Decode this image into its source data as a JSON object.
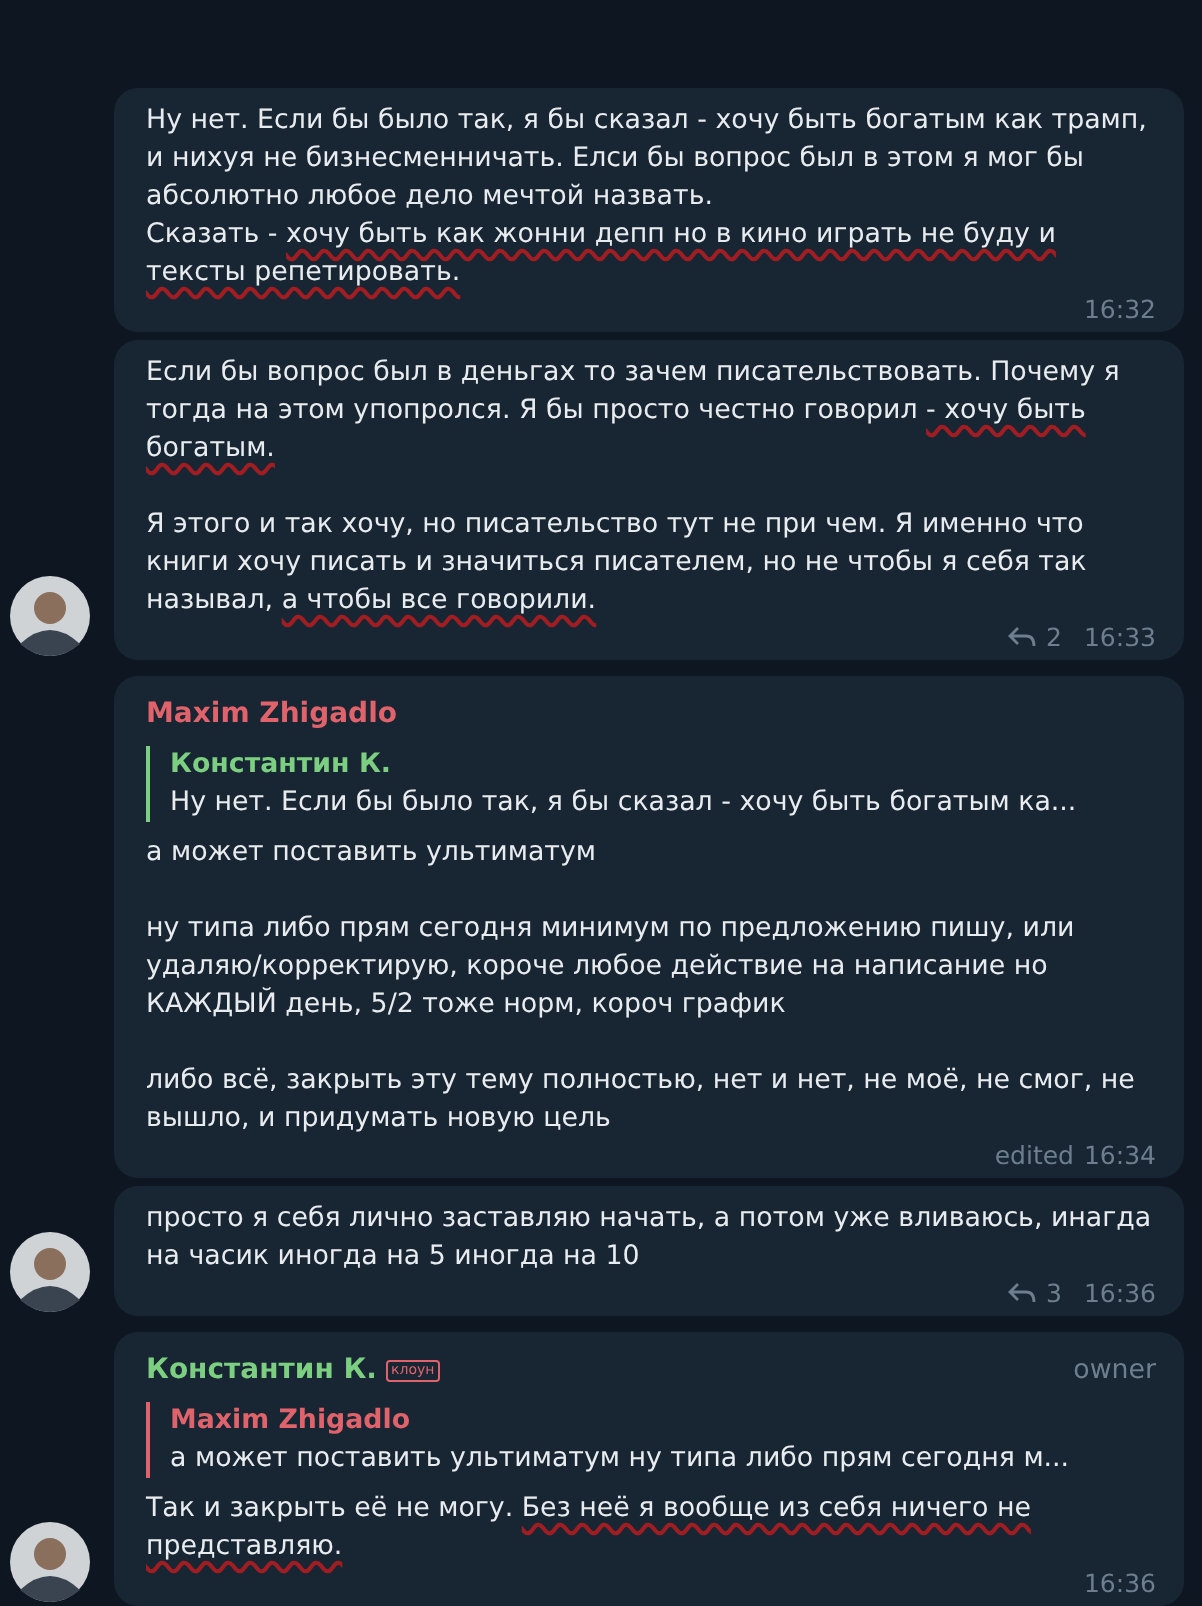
{
  "groups": [
    {
      "messages": [
        {
          "blocks": [
            [
              [
                {
                  "text": "Ну нет. Если бы было так, я бы сказал - хочу быть богатым как трамп, и нихуя не бизнесменничать. Елси бы вопрос был в этом я мог бы абсолютно любое дело мечтой назвать."
                }
              ],
              [
                {
                  "text": "Сказать - ",
                  "underlined": false
                },
                {
                  "text": "хочу быть как жонни депп но в кино играть не буду и тексты репетировать.",
                  "underlined": true
                }
              ]
            ]
          ],
          "time": "16:32"
        },
        {
          "blocks": [
            [
              [
                {
                  "text": "Если бы вопрос был в деньгах то зачем писательствовать. Почему я тогда на этом упопролся. Я бы просто честно говорил ",
                  "underlined": false
                },
                {
                  "text": "- хочу быть богатым.",
                  "underlined": true
                }
              ]
            ],
            [
              [
                {
                  "text": "Я этого и так хочу, но писательство тут не при чем. Я именно что книги хочу писать и значиться писателем, но не чтобы я себя так называл, ",
                  "underlined": false
                },
                {
                  "text": "а чтобы все говорили.",
                  "underlined": true
                }
              ]
            ]
          ],
          "replies": "2",
          "time": "16:33"
        }
      ]
    },
    {
      "messages": [
        {
          "author": "Maxim Zhigadlo",
          "color": "#e0636b",
          "quote": {
            "author": "Константин К.",
            "color": "#7ccf80",
            "text": "Ну нет. Если бы было так, я бы сказал - хочу быть богатым ка..."
          },
          "blocks": [
            [
              [
                {
                  "text": "а может поставить ультиматум"
                }
              ]
            ],
            [
              [
                {
                  "text": "ну типа либо прям сегодня минимум по предложению пишу, или удаляю/корректирую, короче любое действие на написание но КАЖДЫЙ день, 5/2 тоже норм, короч график"
                }
              ]
            ],
            [
              [
                {
                  "text": "либо всё, закрыть эту тему полностью, нет и нет, не моё, не смог, не вышло, и придумать новую цель"
                }
              ]
            ]
          ],
          "edited": "edited",
          "time": "16:34"
        },
        {
          "blocks": [
            [
              [
                {
                  "text": "просто я себя лично заставляю начать, а потом уже вливаюсь, инагда на часик иногда на 5 иногда на 10"
                }
              ]
            ]
          ],
          "replies": "3",
          "time": "16:36"
        }
      ]
    },
    {
      "messages": [
        {
          "author": "Константин К.",
          "color": "#7ccf80",
          "badge": "клоун",
          "role": "owner",
          "quote": {
            "author": "Maxim Zhigadlo",
            "color": "#e0636b",
            "text": "а может поставить ультиматум  ну типа либо прям сегодня м..."
          },
          "blocks": [
            [
              [
                {
                  "text": "Так и закрыть её не могу. ",
                  "underlined": false
                },
                {
                  "text": "Без неё я вообще из себя ничего не",
                  "underlined": true
                }
              ],
              [
                {
                  "text": "представляю.",
                  "underlined": true
                }
              ]
            ]
          ],
          "time": "16:36"
        }
      ]
    }
  ]
}
